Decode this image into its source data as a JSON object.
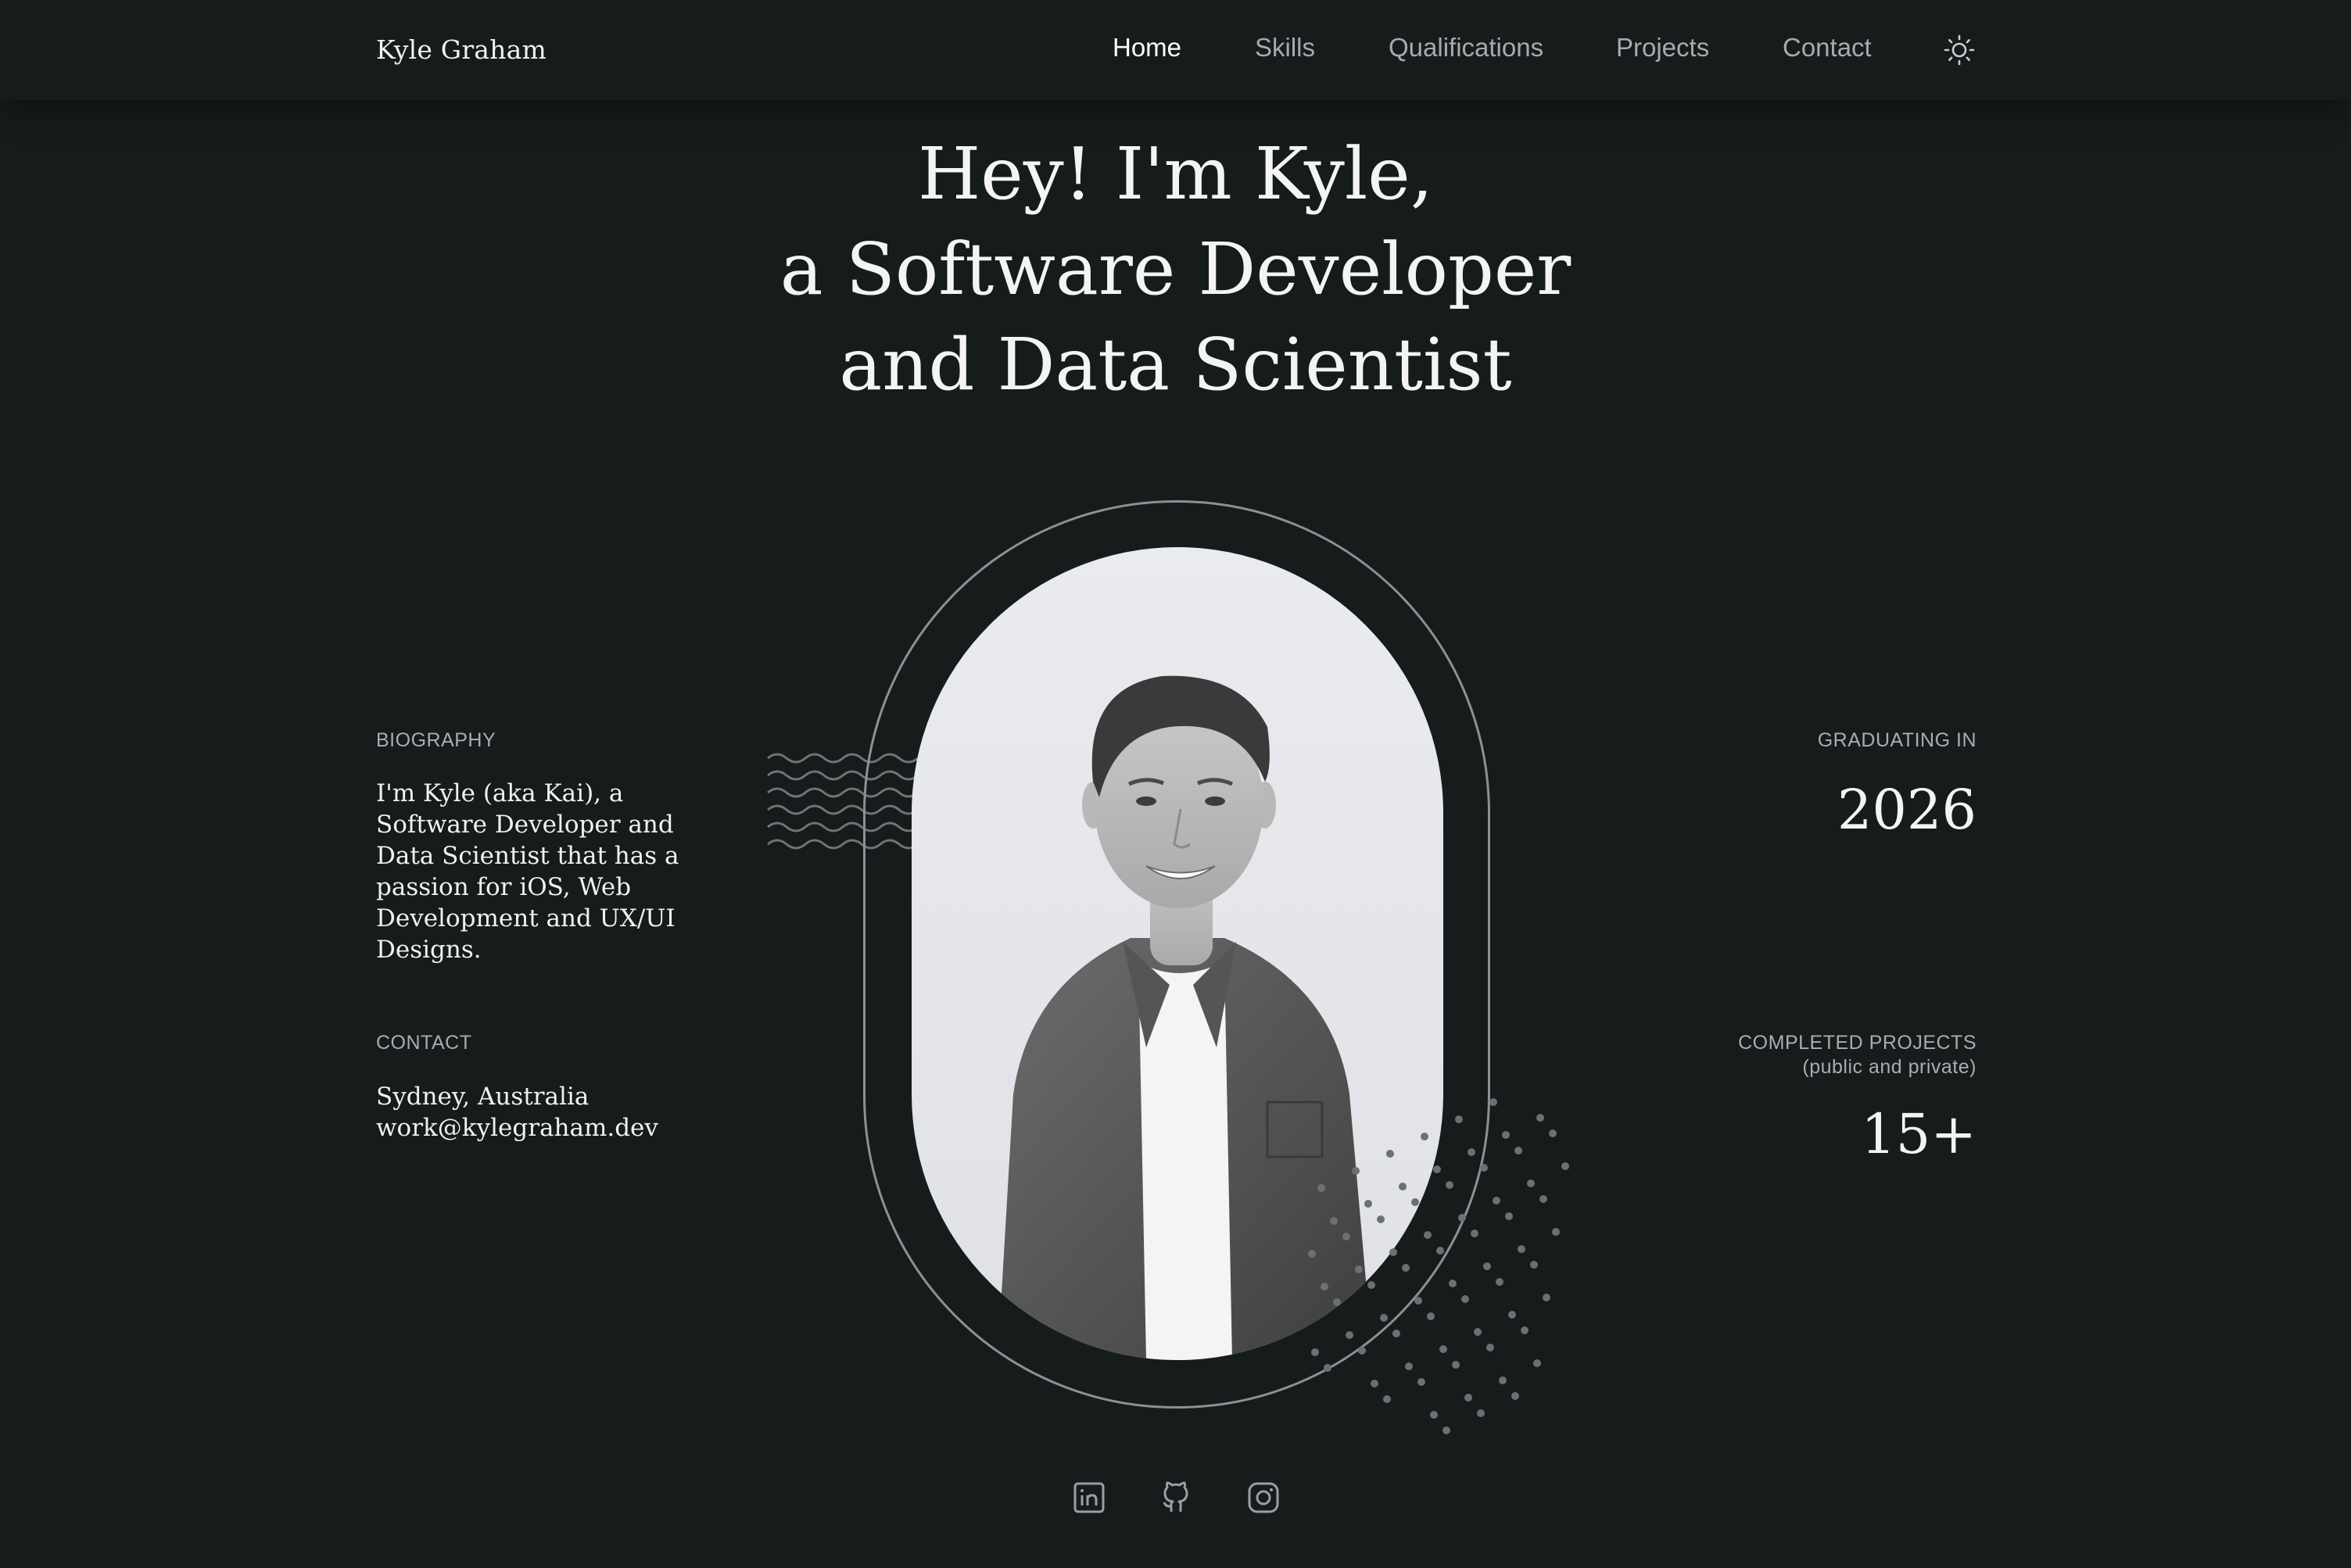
{
  "header": {
    "brand": "Kyle Graham",
    "nav": [
      "Home",
      "Skills",
      "Qualifications",
      "Projects",
      "Contact"
    ],
    "active": "Home",
    "theme_icon": "sun-icon"
  },
  "hero": {
    "line1": "Hey! I'm Kyle,",
    "line2": "a Software Developer",
    "line3": "and Data Scientist"
  },
  "biography": {
    "label": "BIOGRAPHY",
    "text": "I'm Kyle (aka Kai), a Software Developer and Data Scientist that has a passion for iOS, Web Development and UX/UI Designs."
  },
  "contact": {
    "label": "CONTACT",
    "location": "Sydney, Australia",
    "email": "work@kylegraham.dev"
  },
  "graduating": {
    "label": "GRADUATING IN",
    "value": "2026"
  },
  "projects": {
    "label": "COMPLETED PROJECTS",
    "sublabel": "(public and private)",
    "value": "15+"
  },
  "socials": [
    "linkedin-icon",
    "github-icon",
    "instagram-icon"
  ],
  "colors": {
    "background": "#161b1c",
    "text": "#f4f4f4",
    "muted": "#a8adb0",
    "outline": "#8d9193"
  }
}
